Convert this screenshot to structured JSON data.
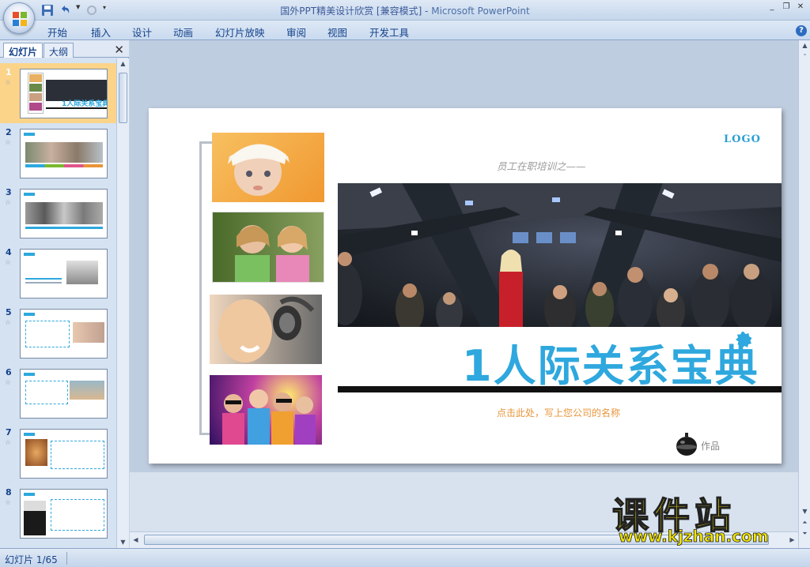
{
  "window": {
    "title": "国外PPT精美设计欣赏 [兼容模式] - ",
    "app_name": "Microsoft PowerPoint"
  },
  "menu": {
    "tabs": [
      "开始",
      "插入",
      "设计",
      "动画",
      "幻灯片放映",
      "审阅",
      "视图",
      "开发工具"
    ]
  },
  "panel": {
    "tab_slides": "幻灯片",
    "tab_outline": "大纲",
    "thumbnails": [
      {
        "num": "1",
        "selected": true
      },
      {
        "num": "2",
        "selected": false
      },
      {
        "num": "3",
        "selected": false
      },
      {
        "num": "4",
        "selected": false
      },
      {
        "num": "5",
        "selected": false
      },
      {
        "num": "6",
        "selected": false
      },
      {
        "num": "7",
        "selected": false
      },
      {
        "num": "8",
        "selected": false
      }
    ],
    "thumb1_title": "1人际关系宝典"
  },
  "slide": {
    "logo": "LOGO",
    "subtitle": "员工在职培训之——",
    "title": "1人际关系宝典",
    "company": "点击此处，写上您公司的名称",
    "author": "作品"
  },
  "status": {
    "slide_counter": "幻灯片 1/65"
  },
  "watermark": {
    "title": "课件站",
    "url": "www.kjzhan.com"
  },
  "colors": {
    "accent": "#2ea8de",
    "company_text": "#e8953a",
    "selected_thumb": "#fbd48a"
  }
}
